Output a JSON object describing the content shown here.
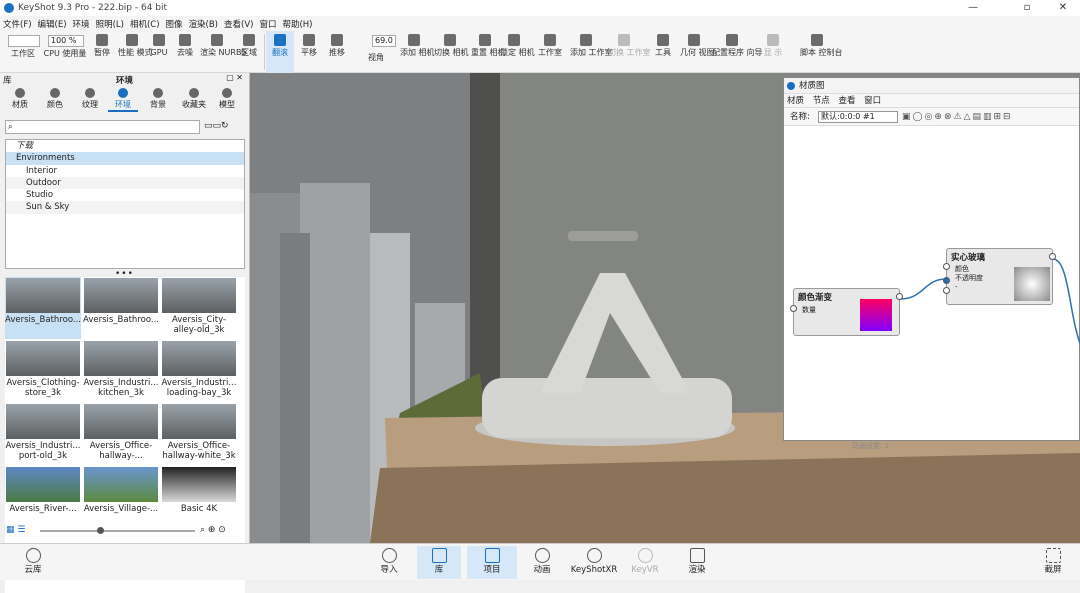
{
  "window": {
    "title": "KeyShot 9.3 Pro - 222.bip - 64 bit"
  },
  "menu": [
    "文件(F)",
    "编辑(E)",
    "环境",
    "照明(L)",
    "相机(C)",
    "图像",
    "渲染(B)",
    "查看(V)",
    "窗口",
    "帮助(H)"
  ],
  "toolbar": {
    "workspace_select": "",
    "zoom_select": "100 %",
    "fov_value": "69.0",
    "buttons": [
      {
        "label": "工作区"
      },
      {
        "label": "CPU 使用量"
      },
      {
        "label": "暂停"
      },
      {
        "label": "性能 模式"
      },
      {
        "label": "GPU"
      },
      {
        "label": "去噪"
      },
      {
        "label": "渲染 NURBS"
      },
      {
        "label": "区域"
      },
      {
        "label": "翻滚"
      },
      {
        "label": "平移"
      },
      {
        "label": "推移"
      },
      {
        "label": "视角"
      },
      {
        "label": "添加 相机"
      },
      {
        "label": "切换 相机"
      },
      {
        "label": "重置 相机"
      },
      {
        "label": "锁定 相机"
      },
      {
        "label": "工作室"
      },
      {
        "label": "添加 工作室"
      },
      {
        "label": "切换 工作室"
      },
      {
        "label": "工具"
      },
      {
        "label": "几何 视图"
      },
      {
        "label": "配置程序 向导"
      },
      {
        "label": "显 示"
      },
      {
        "label": "脚本 控制台"
      }
    ]
  },
  "library": {
    "title": "环境",
    "corner_label": "库",
    "tabs": [
      {
        "label": "材质"
      },
      {
        "label": "颜色"
      },
      {
        "label": "纹理"
      },
      {
        "label": "环境"
      },
      {
        "label": "背景"
      },
      {
        "label": "收藏夹"
      },
      {
        "label": "模型"
      }
    ],
    "search_placeholder": "",
    "tree": [
      {
        "label": "下载"
      },
      {
        "label": "Environments"
      },
      {
        "label": "Interior"
      },
      {
        "label": "Outdoor"
      },
      {
        "label": "Studio"
      },
      {
        "label": "Sun & Sky"
      }
    ],
    "items": [
      {
        "label": "Aversis_Bathroo..."
      },
      {
        "label": "Aversis_Bathroo..."
      },
      {
        "label": "Aversis_City-alley-old_3k"
      },
      {
        "label": "Aversis_Clothing-store_3k"
      },
      {
        "label": "Aversis_Industri... kitchen_3k"
      },
      {
        "label": "Aversis_Industri... loading-bay_3k"
      },
      {
        "label": "Aversis_Industri... port-old_3k"
      },
      {
        "label": "Aversis_Office-hallway-..."
      },
      {
        "label": "Aversis_Office-hallway-white_3k"
      },
      {
        "label": "Aversis_River-..."
      },
      {
        "label": "Aversis_Village-..."
      },
      {
        "label": "Basic 4K"
      }
    ]
  },
  "material_graph": {
    "title": "材质图",
    "menu": [
      "材质",
      "节点",
      "查看",
      "窗口"
    ],
    "name_label": "名称:",
    "name_value": "默认:0:0:0 #1",
    "nodes": {
      "gradient": {
        "title": "颜色渐变",
        "port": "数量"
      },
      "glass": {
        "title": "实心玻璃",
        "ports": [
          "颜色",
          "不透明度",
          "-"
        ]
      }
    },
    "hidden_text": "动画设置: 1"
  },
  "bottom": {
    "cloud_library": "云库",
    "import": "导入",
    "library": "库",
    "project": "项目",
    "animation": "动画",
    "keyshotxr": "KeyShotXR",
    "keyvr": "KeyVR",
    "render": "渲染",
    "screenshot": "截屏"
  },
  "colors": {
    "accent": "#1a6fc2",
    "active_bg": "#d6e8f7",
    "selection": "#c7e0f4"
  }
}
